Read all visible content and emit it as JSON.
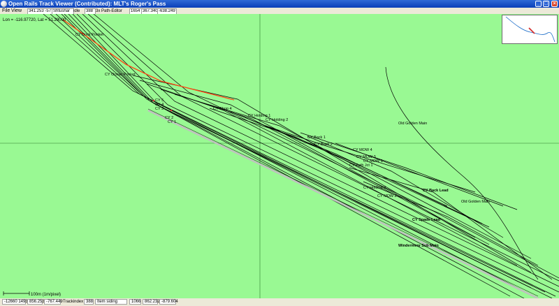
{
  "window": {
    "title": "Open Rails Track Viewer (Contributed): MLT's Roger's Pass",
    "buttons": [
      "minimize",
      "maximize",
      "close"
    ]
  },
  "menu": [
    "File",
    "View"
  ],
  "toolbar": {
    "coord_field": "341.253 -57",
    "search_text": "Shtushar",
    "idle_label": "idle",
    "index_value": "388",
    "path_editor_label": "3x Path-Editor",
    "field_a": "1654",
    "field_b": "367.340",
    "field_c": "-638.249"
  },
  "canvas": {
    "coords_text": "Lon = -116.97720, Lat = 51.29000",
    "scale_text": "100m (1m/pixel)",
    "labels": [
      "CY Dock Pocket",
      "CY Ocean Pocket",
      "CY 5",
      "CY 4",
      "CY 3",
      "CY 2",
      "CY 1",
      "CY Shop 4",
      "CY Holding 1",
      "CY Holding 2",
      "CY Back 1",
      "CY Back 2",
      "CY MOW 4",
      "CY MOW 3",
      "CY MOW 1",
      "CY Path Jct 1",
      "CY Holding 3",
      "CY MOW 2",
      "CY Back Lead",
      "CY Spade Lead",
      "Old Golden Main",
      "Old Golden Main",
      "Windermere Sub Main"
    ]
  },
  "statusbar": {
    "coord_a": "-12660 1493",
    "coord_b": "856.253",
    "coord_c": "-767.449",
    "trackindex_label": "Trackindex",
    "trackindex_value": "388",
    "item_field": "Item siding",
    "field_d": "1066",
    "field_e": "862.232",
    "field_f": "-879.604"
  },
  "colors": {
    "background_green": "#99f993",
    "track": "#000000",
    "highlight_track": "#c0c0c0",
    "selected_track": "#ff4a17",
    "title_blue": "#0a3fb8",
    "crosshair": "#2d7a2d"
  },
  "icons": [
    "app-icon",
    "minimize-icon",
    "maximize-icon",
    "close-icon"
  ]
}
